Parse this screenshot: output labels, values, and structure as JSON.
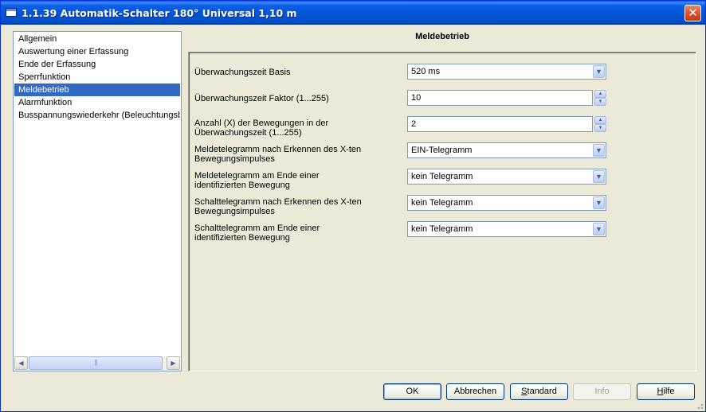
{
  "window": {
    "title": "1.1.39 Automatik-Schalter 180° Universal 1,10 m",
    "close_label": "✕"
  },
  "tree": {
    "items": [
      {
        "label": "Allgemein",
        "selected": false
      },
      {
        "label": "Auswertung einer Erfassung",
        "selected": false
      },
      {
        "label": "Ende der Erfassung",
        "selected": false
      },
      {
        "label": "Sperrfunktion",
        "selected": false
      },
      {
        "label": "Meldebetrieb",
        "selected": true
      },
      {
        "label": "Alarmfunktion",
        "selected": false
      },
      {
        "label": "Busspannungswiederkehr (Beleuchtungsbe",
        "selected": false
      }
    ],
    "scroll_left_icon": "◀",
    "scroll_right_icon": "▶",
    "scroll_thumb_grip": "|||"
  },
  "panel": {
    "title": "Meldebetrieb",
    "params": [
      {
        "label_lines": [
          "Überwachungszeit Basis"
        ],
        "value": "520 ms",
        "control": "dropdown"
      },
      {
        "label_lines": [
          "Überwachungszeit Faktor (1...255)"
        ],
        "value": "10",
        "control": "spinner"
      },
      {
        "label_lines": [
          "Anzahl (X) der Bewegungen in der",
          "Überwachungszeit (1...255)"
        ],
        "value": "2",
        "control": "spinner"
      },
      {
        "label_lines": [
          "Meldetelegramm nach Erkennen des X-ten",
          "Bewegungsimpulses"
        ],
        "value": "EIN-Telegramm",
        "control": "dropdown"
      },
      {
        "label_lines": [
          "Meldetelegramm am Ende einer",
          "identifizierten Bewegung"
        ],
        "value": "kein Telegramm",
        "control": "dropdown"
      },
      {
        "label_lines": [
          "Schalttelegramm nach Erkennen des X-ten",
          "Bewegungsimpulses"
        ],
        "value": "kein Telegramm",
        "control": "dropdown"
      },
      {
        "label_lines": [
          "Schalttelegramm am Ende einer",
          "identifizierten Bewegung"
        ],
        "value": "kein Telegramm",
        "control": "dropdown"
      }
    ],
    "dropdown_icon": "▼",
    "spin_up_icon": "▲",
    "spin_down_icon": "▼"
  },
  "footer": {
    "ok": "OK",
    "cancel": "Abbrechen",
    "standard": "Standard",
    "info": "Info",
    "help": "Hilfe"
  }
}
